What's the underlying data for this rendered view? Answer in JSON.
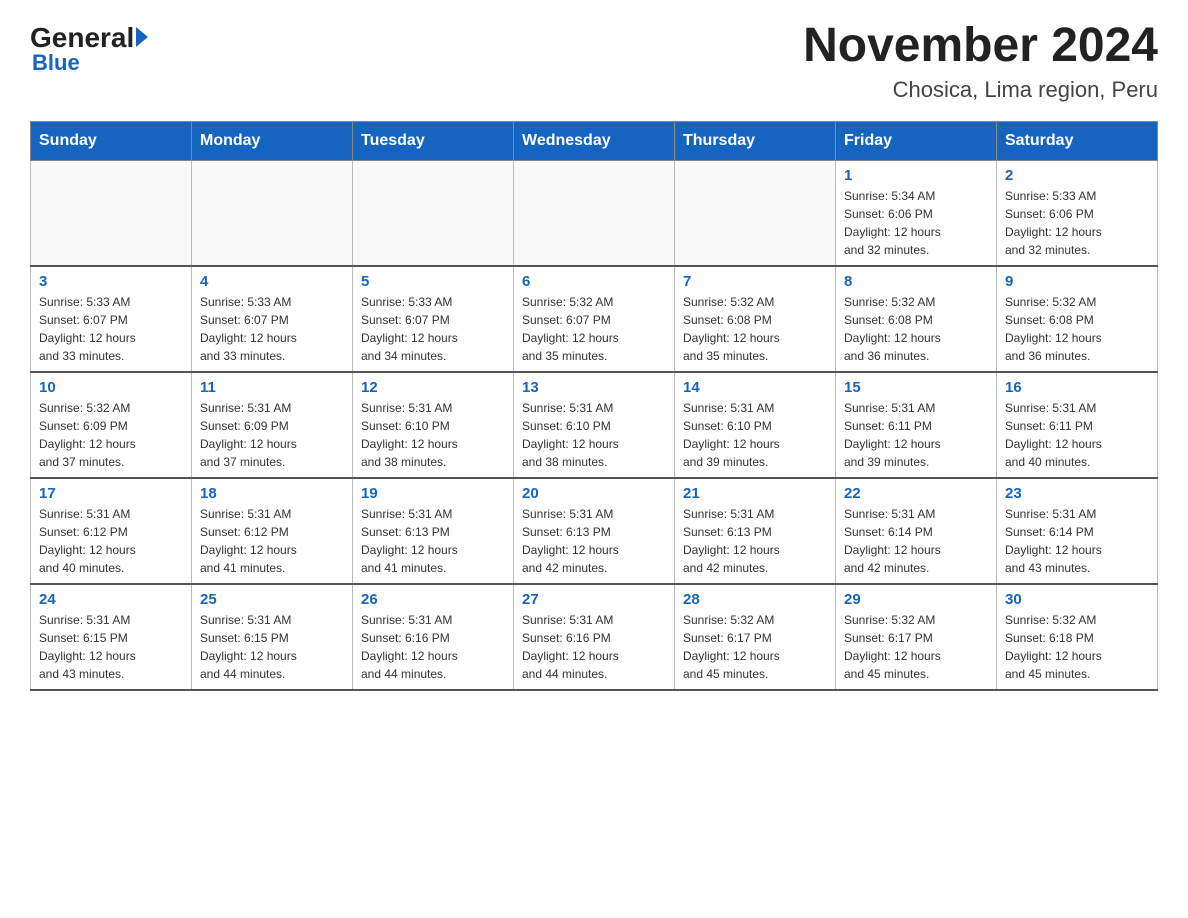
{
  "logo": {
    "general": "General",
    "blue": "Blue"
  },
  "title": "November 2024",
  "subtitle": "Chosica, Lima region, Peru",
  "days_of_week": [
    "Sunday",
    "Monday",
    "Tuesday",
    "Wednesday",
    "Thursday",
    "Friday",
    "Saturday"
  ],
  "weeks": [
    [
      {
        "day": "",
        "info": ""
      },
      {
        "day": "",
        "info": ""
      },
      {
        "day": "",
        "info": ""
      },
      {
        "day": "",
        "info": ""
      },
      {
        "day": "",
        "info": ""
      },
      {
        "day": "1",
        "info": "Sunrise: 5:34 AM\nSunset: 6:06 PM\nDaylight: 12 hours\nand 32 minutes."
      },
      {
        "day": "2",
        "info": "Sunrise: 5:33 AM\nSunset: 6:06 PM\nDaylight: 12 hours\nand 32 minutes."
      }
    ],
    [
      {
        "day": "3",
        "info": "Sunrise: 5:33 AM\nSunset: 6:07 PM\nDaylight: 12 hours\nand 33 minutes."
      },
      {
        "day": "4",
        "info": "Sunrise: 5:33 AM\nSunset: 6:07 PM\nDaylight: 12 hours\nand 33 minutes."
      },
      {
        "day": "5",
        "info": "Sunrise: 5:33 AM\nSunset: 6:07 PM\nDaylight: 12 hours\nand 34 minutes."
      },
      {
        "day": "6",
        "info": "Sunrise: 5:32 AM\nSunset: 6:07 PM\nDaylight: 12 hours\nand 35 minutes."
      },
      {
        "day": "7",
        "info": "Sunrise: 5:32 AM\nSunset: 6:08 PM\nDaylight: 12 hours\nand 35 minutes."
      },
      {
        "day": "8",
        "info": "Sunrise: 5:32 AM\nSunset: 6:08 PM\nDaylight: 12 hours\nand 36 minutes."
      },
      {
        "day": "9",
        "info": "Sunrise: 5:32 AM\nSunset: 6:08 PM\nDaylight: 12 hours\nand 36 minutes."
      }
    ],
    [
      {
        "day": "10",
        "info": "Sunrise: 5:32 AM\nSunset: 6:09 PM\nDaylight: 12 hours\nand 37 minutes."
      },
      {
        "day": "11",
        "info": "Sunrise: 5:31 AM\nSunset: 6:09 PM\nDaylight: 12 hours\nand 37 minutes."
      },
      {
        "day": "12",
        "info": "Sunrise: 5:31 AM\nSunset: 6:10 PM\nDaylight: 12 hours\nand 38 minutes."
      },
      {
        "day": "13",
        "info": "Sunrise: 5:31 AM\nSunset: 6:10 PM\nDaylight: 12 hours\nand 38 minutes."
      },
      {
        "day": "14",
        "info": "Sunrise: 5:31 AM\nSunset: 6:10 PM\nDaylight: 12 hours\nand 39 minutes."
      },
      {
        "day": "15",
        "info": "Sunrise: 5:31 AM\nSunset: 6:11 PM\nDaylight: 12 hours\nand 39 minutes."
      },
      {
        "day": "16",
        "info": "Sunrise: 5:31 AM\nSunset: 6:11 PM\nDaylight: 12 hours\nand 40 minutes."
      }
    ],
    [
      {
        "day": "17",
        "info": "Sunrise: 5:31 AM\nSunset: 6:12 PM\nDaylight: 12 hours\nand 40 minutes."
      },
      {
        "day": "18",
        "info": "Sunrise: 5:31 AM\nSunset: 6:12 PM\nDaylight: 12 hours\nand 41 minutes."
      },
      {
        "day": "19",
        "info": "Sunrise: 5:31 AM\nSunset: 6:13 PM\nDaylight: 12 hours\nand 41 minutes."
      },
      {
        "day": "20",
        "info": "Sunrise: 5:31 AM\nSunset: 6:13 PM\nDaylight: 12 hours\nand 42 minutes."
      },
      {
        "day": "21",
        "info": "Sunrise: 5:31 AM\nSunset: 6:13 PM\nDaylight: 12 hours\nand 42 minutes."
      },
      {
        "day": "22",
        "info": "Sunrise: 5:31 AM\nSunset: 6:14 PM\nDaylight: 12 hours\nand 42 minutes."
      },
      {
        "day": "23",
        "info": "Sunrise: 5:31 AM\nSunset: 6:14 PM\nDaylight: 12 hours\nand 43 minutes."
      }
    ],
    [
      {
        "day": "24",
        "info": "Sunrise: 5:31 AM\nSunset: 6:15 PM\nDaylight: 12 hours\nand 43 minutes."
      },
      {
        "day": "25",
        "info": "Sunrise: 5:31 AM\nSunset: 6:15 PM\nDaylight: 12 hours\nand 44 minutes."
      },
      {
        "day": "26",
        "info": "Sunrise: 5:31 AM\nSunset: 6:16 PM\nDaylight: 12 hours\nand 44 minutes."
      },
      {
        "day": "27",
        "info": "Sunrise: 5:31 AM\nSunset: 6:16 PM\nDaylight: 12 hours\nand 44 minutes."
      },
      {
        "day": "28",
        "info": "Sunrise: 5:32 AM\nSunset: 6:17 PM\nDaylight: 12 hours\nand 45 minutes."
      },
      {
        "day": "29",
        "info": "Sunrise: 5:32 AM\nSunset: 6:17 PM\nDaylight: 12 hours\nand 45 minutes."
      },
      {
        "day": "30",
        "info": "Sunrise: 5:32 AM\nSunset: 6:18 PM\nDaylight: 12 hours\nand 45 minutes."
      }
    ]
  ]
}
